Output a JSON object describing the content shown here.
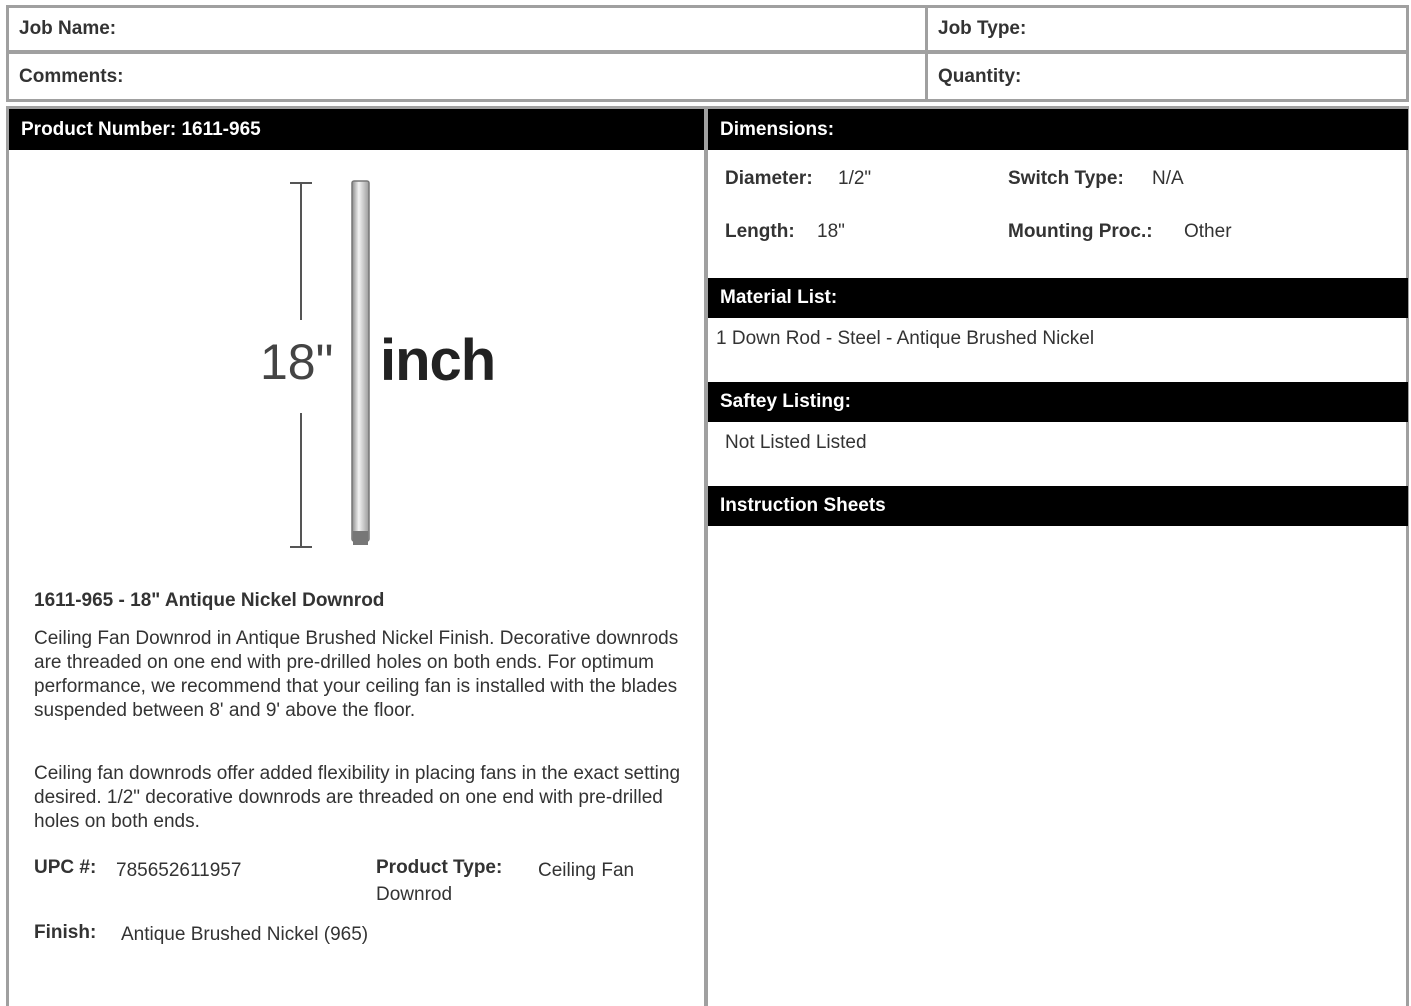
{
  "header": {
    "job_name_label": "Job Name:",
    "job_type_label": "Job Type:",
    "comments_label": "Comments:",
    "quantity_label": "Quantity:"
  },
  "product": {
    "number_bar": "Product Number: 1611-965",
    "image": {
      "size_label": "18\"",
      "unit_label": "inch"
    },
    "title": "1611-965 - 18\" Antique Nickel Downrod",
    "description": [
      "Ceiling Fan Downrod in Antique Brushed Nickel Finish. Decorative downrods are threaded on one end with pre-drilled holes on both ends. For optimum performance, we recommend that your ceiling fan is installed with the blades suspended between 8' and 9' above the floor.",
      "Ceiling fan downrods offer added flexibility in placing fans in the exact setting desired. 1/2\" decorative downrods are threaded on one end with pre-drilled holes on both ends."
    ],
    "upc_label": "UPC #:",
    "upc_value": "785652611957",
    "type_label": "Product Type:",
    "type_value_line1": "Ceiling Fan",
    "type_value_line2": "Downrod",
    "finish_label": "Finish:",
    "finish_value": "Antique Brushed Nickel (965)"
  },
  "dimensions": {
    "bar": "Dimensions:",
    "diameter_label": "Diameter:",
    "diameter_value": "1/2\"",
    "switch_label": "Switch Type:",
    "switch_value": "N/A",
    "length_label": "Length:",
    "length_value": "18\"",
    "mounting_label": "Mounting Proc.:",
    "mounting_value": "Other"
  },
  "materials": {
    "bar": "Material List:",
    "item": "1 Down Rod - Steel - Antique Brushed Nickel"
  },
  "safety": {
    "bar": "Saftey Listing:",
    "value": "Not Listed Listed"
  },
  "instructions": {
    "bar": "Instruction Sheets"
  }
}
